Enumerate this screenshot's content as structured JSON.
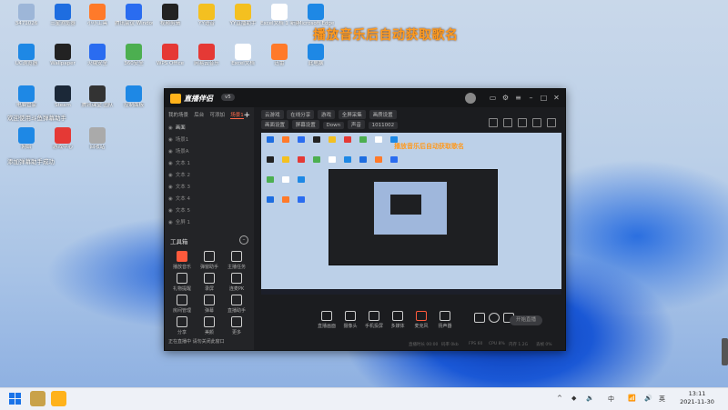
{
  "banner": "播放音乐后自动获取歌名",
  "desktop": {
    "icons": [
      {
        "label": "3471026",
        "color": "#9db6d8"
      },
      {
        "label": "三星浏览器",
        "color": "#1e6de0"
      },
      {
        "label": "小小工具",
        "color": "#ff7a2a"
      },
      {
        "label": "腾讯会议 Windows版",
        "color": "#2a6cf0"
      },
      {
        "label": "视频剪辑",
        "color": "#222"
      },
      {
        "label": "YY语音",
        "color": "#f4c020"
      },
      {
        "label": "YY直播助手",
        "color": "#f4c020"
      },
      {
        "label": "Excel文档 1 新建",
        "color": "#ffffff"
      },
      {
        "label": "Microsoft Edge",
        "color": "#1e88e5"
      },
      {
        "label": "UC浏览器",
        "color": "#1e88e5"
      },
      {
        "label": "Wallpaper",
        "color": "#222"
      },
      {
        "label": "火绒安全",
        "color": "#2a6cf0"
      },
      {
        "label": "360安全",
        "color": "#4caf50"
      },
      {
        "label": "WPS Office",
        "color": "#e53935"
      },
      {
        "label": "网易云音乐",
        "color": "#e53935"
      },
      {
        "label": "Excel文档",
        "color": "#ffffff"
      },
      {
        "label": "迅雷",
        "color": "#ff7a2a"
      },
      {
        "label": "此电脑",
        "color": "#1e88e5"
      },
      {
        "label": "电脑管家",
        "color": "#1e88e5"
      },
      {
        "label": "Steam",
        "color": "#1b2838"
      },
      {
        "label": "腾讯课堂 团队",
        "color": "#333"
      },
      {
        "label": "控制面板",
        "color": "#1e88e5"
      },
      {
        "label": "网络",
        "color": "#1e88e5"
      },
      {
        "label": "游戏中心",
        "color": "#e53935"
      },
      {
        "label": "回收站",
        "color": "#aaa"
      }
    ],
    "toasts": [
      "欢迎使用斗鱼弹幕助手",
      "添加弹幕助手成功"
    ]
  },
  "app": {
    "name": "直播伴侣",
    "version": "v5",
    "tabs": [
      "我的场景",
      "后台",
      "可添加",
      "场景1"
    ],
    "scenes": [
      "画面",
      "场景1",
      "场景A",
      "文本 1",
      "文本 2",
      "文本 3",
      "文本 4",
      "文本 5",
      "全屏 1"
    ],
    "tools_title": "工具箱",
    "tools": [
      {
        "label": "播放音乐",
        "red": true
      },
      {
        "label": "弹窗助手",
        "red": false
      },
      {
        "label": "主播任务",
        "red": false
      },
      {
        "label": "礼物提醒",
        "red": false
      },
      {
        "label": "录屏",
        "red": false
      },
      {
        "label": "连麦PK",
        "red": false
      },
      {
        "label": "房间管理",
        "red": false
      },
      {
        "label": "弹幕",
        "red": false
      },
      {
        "label": "直播助手",
        "red": false
      },
      {
        "label": "分享",
        "red": false
      },
      {
        "label": "美颜",
        "red": false
      },
      {
        "label": "更多",
        "red": false
      }
    ],
    "sidenote": "正在直播中 请勿关闭此窗口",
    "source_bar": [
      "云游戏",
      "在线分享",
      "游戏",
      "全屏采集",
      "画质设置"
    ],
    "source_bar2": [
      "画面设置",
      "屏幕设置",
      "Down",
      "声音",
      "1011002"
    ],
    "controls": [
      {
        "label": "直播画面",
        "red": false
      },
      {
        "label": "摄像头",
        "red": false
      },
      {
        "label": "手机投屏",
        "red": false
      },
      {
        "label": "多媒体",
        "red": false
      },
      {
        "label": "麦克风",
        "red": true
      },
      {
        "label": "扬声器",
        "red": false
      }
    ],
    "golive": "开始直播",
    "status": [
      "直播时长 00:00",
      "码率 0kb",
      "FPS 60",
      "CPU 8%",
      "内存 1.2G",
      "丢帧 0%"
    ]
  },
  "taskbar": {
    "tray": [
      "^",
      "中",
      "英"
    ],
    "time": "13:11",
    "date": "2021-11-30"
  }
}
